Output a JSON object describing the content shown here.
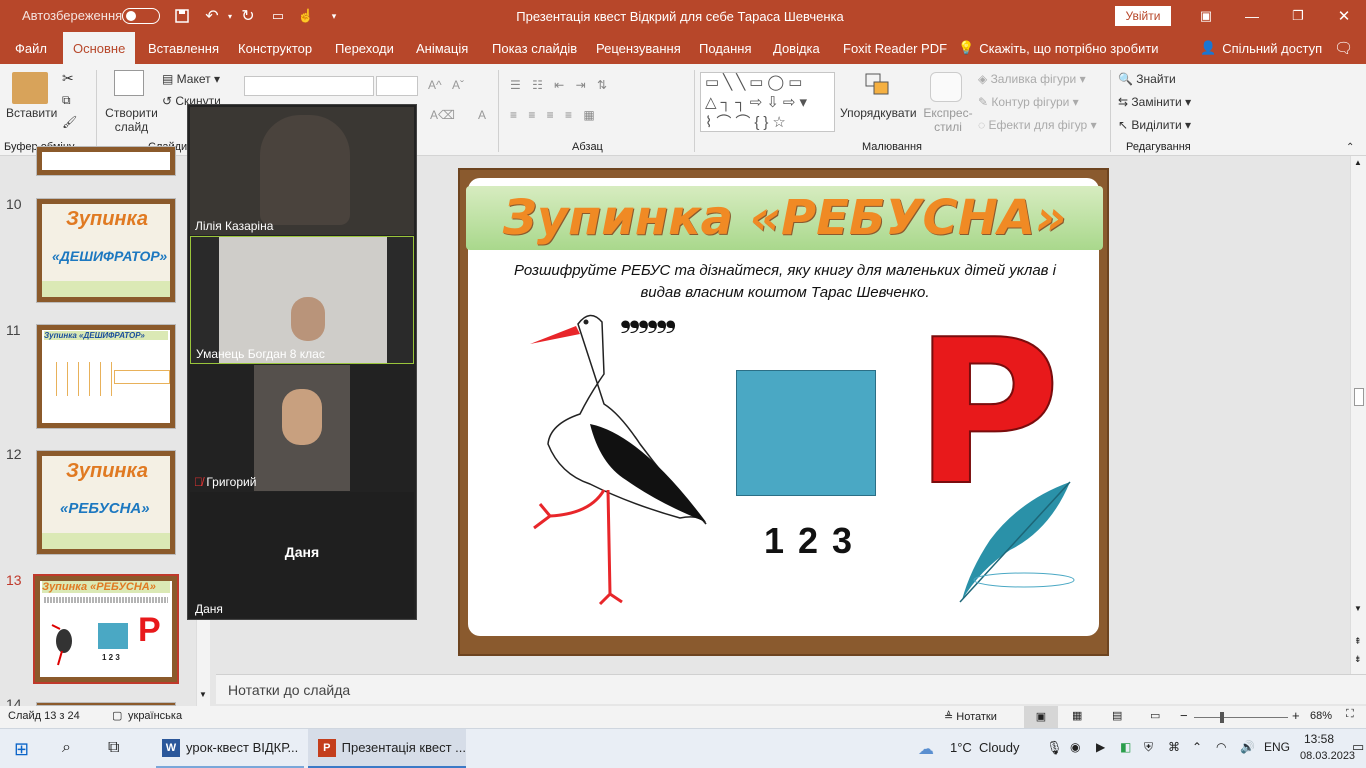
{
  "titlebar": {
    "autosave_label": "Автозбереження",
    "autosave_state": "off",
    "doc_title": "Презентація квест Відкрий для себе Тараса Шевченка",
    "signin_button": "Увійти",
    "brand_color": "#b7472a"
  },
  "tabs": [
    "Файл",
    "Основне",
    "Вставлення",
    "Конструктор",
    "Переходи",
    "Анімація",
    "Показ слайдів",
    "Рецензування",
    "Подання",
    "Довідка",
    "Foxit Reader PDF",
    "Скажіть, що потрібно зробити",
    "Спільний доступ"
  ],
  "ribbon": {
    "paste": "Вставити",
    "clipboard_group": "Буфер обміну",
    "new_slide": "Створити слайд",
    "layout": "Макет",
    "reset": "Скинути",
    "slides_group": "Слайди",
    "paragraph_group": "Абзац",
    "arrange": "Упорядкувати",
    "quick_styles": "Експрес-стилі",
    "shape_fill": "Заливка фігури",
    "shape_outline": "Контур фігури",
    "shape_effects": "Ефекти для фігур",
    "drawing_group": "Малювання",
    "find": "Знайти",
    "replace": "Замінити",
    "select": "Виділити",
    "editing_group": "Редагування"
  },
  "thumbnails": [
    {
      "num": "10",
      "title": "Зупинка",
      "subtitle": "«ДЕШИФРАТОР»"
    },
    {
      "num": "11",
      "title": "Зупинка «ДЕШИФРАТОР»"
    },
    {
      "num": "12",
      "title": "Зупинка",
      "subtitle": "«РЕБУСНА»"
    },
    {
      "num": "13",
      "title": "Зупинка «РЕБУСНА»",
      "selected": true
    },
    {
      "num": "14"
    }
  ],
  "slide": {
    "title": "Зупинка «РЕБУСНА»",
    "question": "Розшифруйте РЕБУС та дізнайтеся, яку книгу для маленьких дітей уклав і видав власним коштом Тарас Шевченко.",
    "commas": "❠❠❠",
    "square_numbers": "1 2 3",
    "letter": "Р",
    "square_color": "#4aa8c4",
    "letter_color": "#e8191b",
    "title_color": "#f08a24"
  },
  "video_call": {
    "participants": [
      {
        "name": "Лілія Казаріна",
        "muted": false
      },
      {
        "name": "Уманець Богдан 8 клас",
        "muted": false,
        "active": true
      },
      {
        "name": "Григорий",
        "muted": true
      },
      {
        "name": "Даня",
        "video_off": true
      }
    ]
  },
  "notes_placeholder": "Нотатки до слайда",
  "status": {
    "slide_count": "Слайд 13 з 24",
    "language": "українська",
    "notes_button": "Нотатки",
    "zoom": "68%"
  },
  "taskbar": {
    "apps": [
      {
        "label": "урок-квест ВІДКР...",
        "icon": "word-icon"
      },
      {
        "label": "Презентація квест ...",
        "icon": "powerpoint-icon",
        "active": true
      }
    ],
    "weather": "1°C  Cloudy",
    "lang": "ENG",
    "time": "13:58",
    "date": "08.03.2023"
  }
}
